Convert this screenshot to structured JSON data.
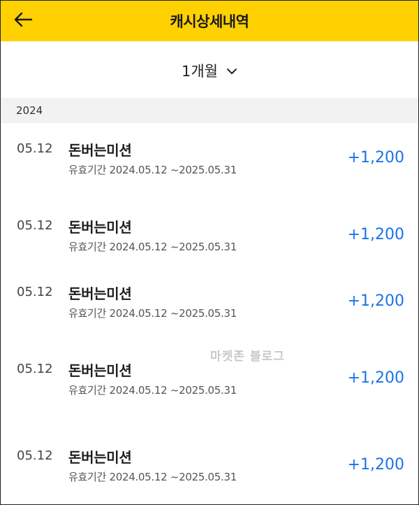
{
  "header": {
    "title": "캐시상세내역",
    "back_icon": "arrow-left-icon",
    "background_color": "#ffd100"
  },
  "filter": {
    "period_label": "1개월",
    "dropdown_icon": "chevron-down-icon"
  },
  "year_section": {
    "label": "2024"
  },
  "rows": [
    {
      "date": "05.12",
      "title": "돈버는미션",
      "period": "유효기간 2024.05.12 ~2025.05.31",
      "amount": "+1,200"
    },
    {
      "date": "05.12",
      "title": "돈버는미션",
      "period": "유효기간 2024.05.12 ~2025.05.31",
      "amount": "+1,200"
    },
    {
      "date": "05.12",
      "title": "돈버는미션",
      "period": "유효기간 2024.05.12 ~2025.05.31",
      "amount": "+1,200"
    },
    {
      "date": "05.12",
      "title": "돈버는미션",
      "period": "유효기간 2024.05.12 ~2025.05.31",
      "amount": "+1,200"
    },
    {
      "date": "05.12",
      "title": "돈버는미션",
      "period": "유효기간 2024.05.12 ~2025.05.31",
      "amount": "+1,200"
    }
  ],
  "watermark": "마켓존 블로그",
  "colors": {
    "amount": "#1a73e8",
    "year_bar": "#f2f2f2"
  }
}
